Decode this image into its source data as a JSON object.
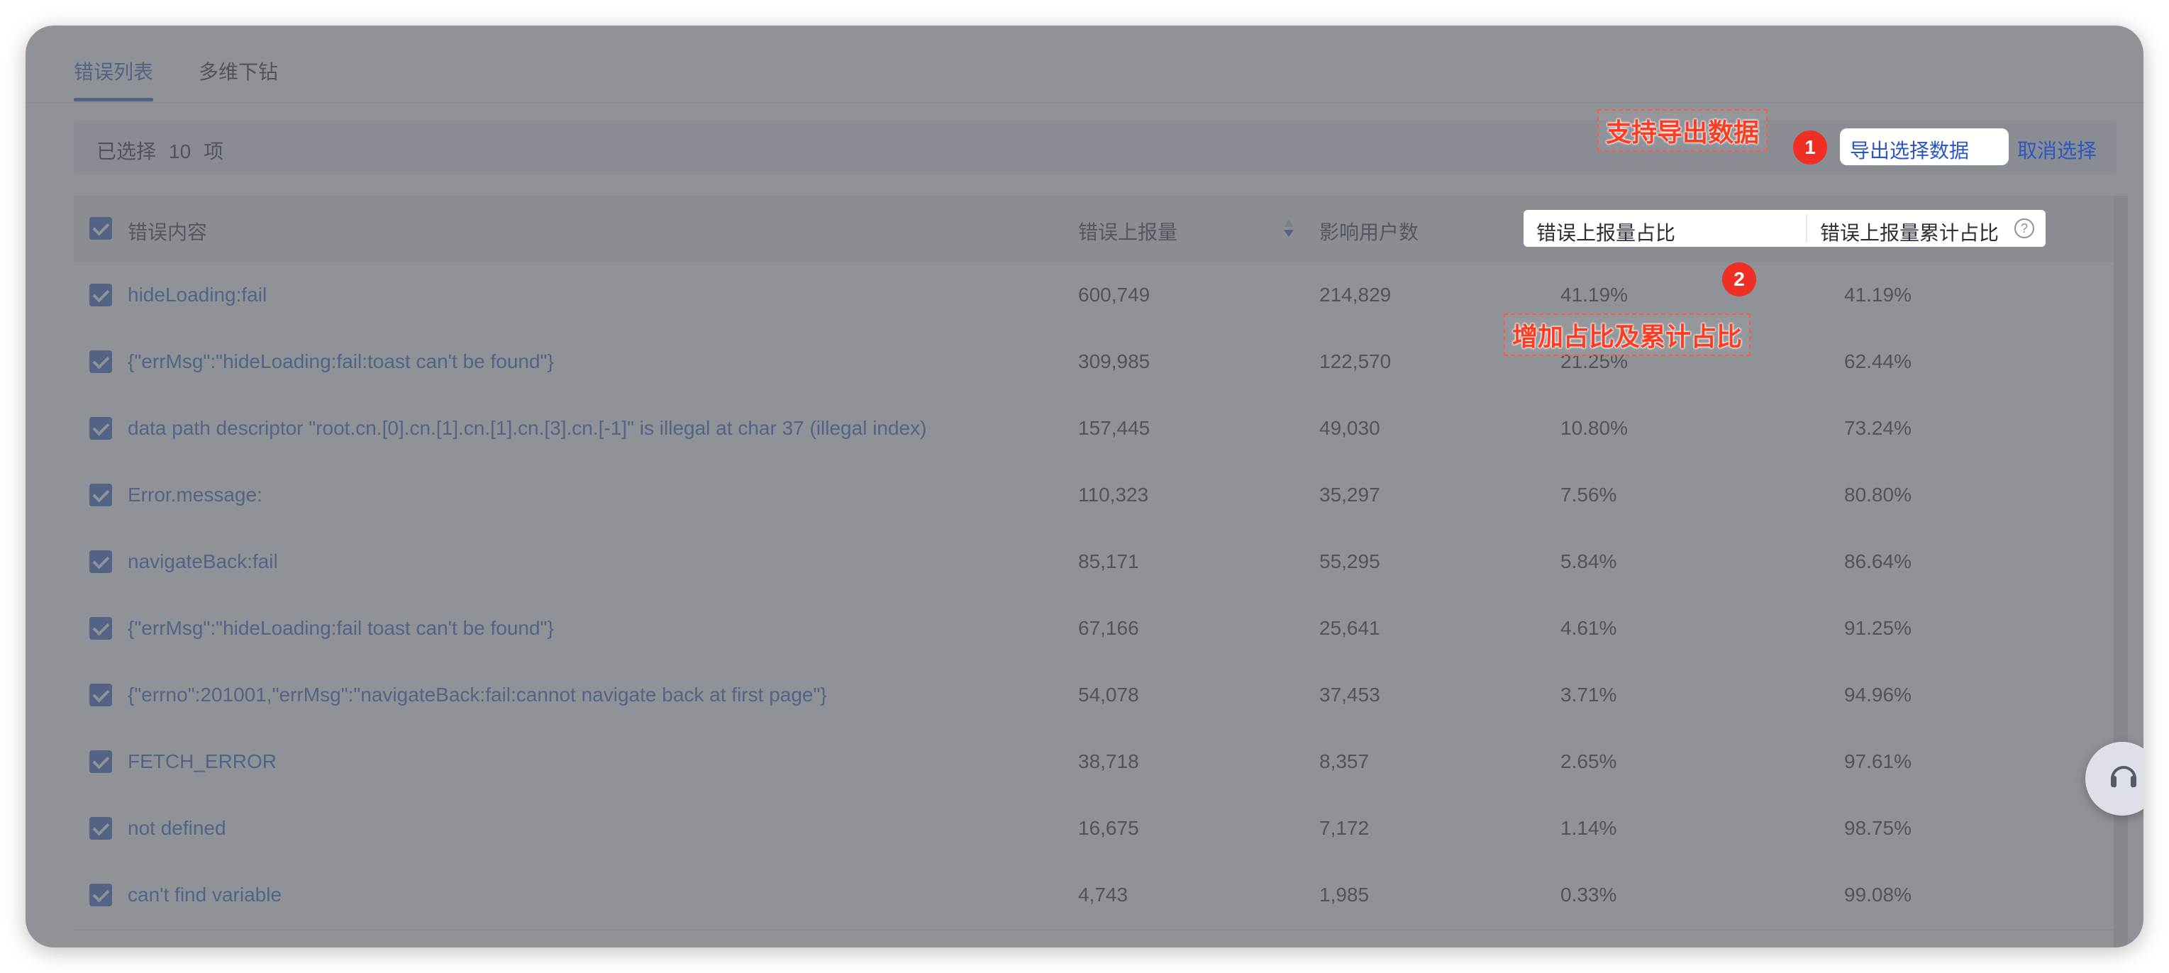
{
  "tabs": [
    {
      "label": "错误列表",
      "active": true
    },
    {
      "label": "多维下钻",
      "active": false
    }
  ],
  "selection": {
    "prefix": "已选择",
    "count": "10",
    "suffix": "项",
    "export_label": "导出选择数据",
    "cancel_label": "取消选择"
  },
  "columns": {
    "content": "错误内容",
    "reports": "错误上报量",
    "users": "影响用户数",
    "ratio": "错误上报量占比",
    "cumulative": "错误上报量累计占比"
  },
  "rows": [
    {
      "content": "hideLoading:fail",
      "reports": "600,749",
      "users": "214,829",
      "ratio": "41.19%",
      "cumulative": "41.19%"
    },
    {
      "content": "{\"errMsg\":\"hideLoading:fail:toast can't be found\"}",
      "reports": "309,985",
      "users": "122,570",
      "ratio": "21.25%",
      "cumulative": "62.44%"
    },
    {
      "content": "data path descriptor \"root.cn.[0].cn.[1].cn.[1].cn.[3].cn.[-1]\" is illegal at char 37 (illegal index)",
      "reports": "157,445",
      "users": "49,030",
      "ratio": "10.80%",
      "cumulative": "73.24%"
    },
    {
      "content": "Error.message:",
      "reports": "110,323",
      "users": "35,297",
      "ratio": "7.56%",
      "cumulative": "80.80%"
    },
    {
      "content": "navigateBack:fail",
      "reports": "85,171",
      "users": "55,295",
      "ratio": "5.84%",
      "cumulative": "86.64%"
    },
    {
      "content": "{\"errMsg\":\"hideLoading:fail toast can't be found\"}",
      "reports": "67,166",
      "users": "25,641",
      "ratio": "4.61%",
      "cumulative": "91.25%"
    },
    {
      "content": "{\"errno\":201001,\"errMsg\":\"navigateBack:fail:cannot navigate back at first page\"}",
      "reports": "54,078",
      "users": "37,453",
      "ratio": "3.71%",
      "cumulative": "94.96%"
    },
    {
      "content": "FETCH_ERROR",
      "reports": "38,718",
      "users": "8,357",
      "ratio": "2.65%",
      "cumulative": "97.61%"
    },
    {
      "content": "not defined",
      "reports": "16,675",
      "users": "7,172",
      "ratio": "1.14%",
      "cumulative": "98.75%"
    },
    {
      "content": "can't find variable",
      "reports": "4,743",
      "users": "1,985",
      "ratio": "0.33%",
      "cumulative": "99.08%"
    }
  ],
  "annotations": [
    {
      "number": "1",
      "text": "支持导出数据"
    },
    {
      "number": "2",
      "text": "增加占比及累计占比"
    }
  ],
  "icons": {
    "help": "question-circle-icon",
    "headset": "headset-icon",
    "back_to_top": "back-to-top-icon",
    "sort": "sort-icon",
    "checkbox": "checkbox-checked-icon"
  },
  "colors": {
    "accent": "#2a56c6",
    "annotation": "#ef2f23",
    "overlay": "#64686e"
  }
}
